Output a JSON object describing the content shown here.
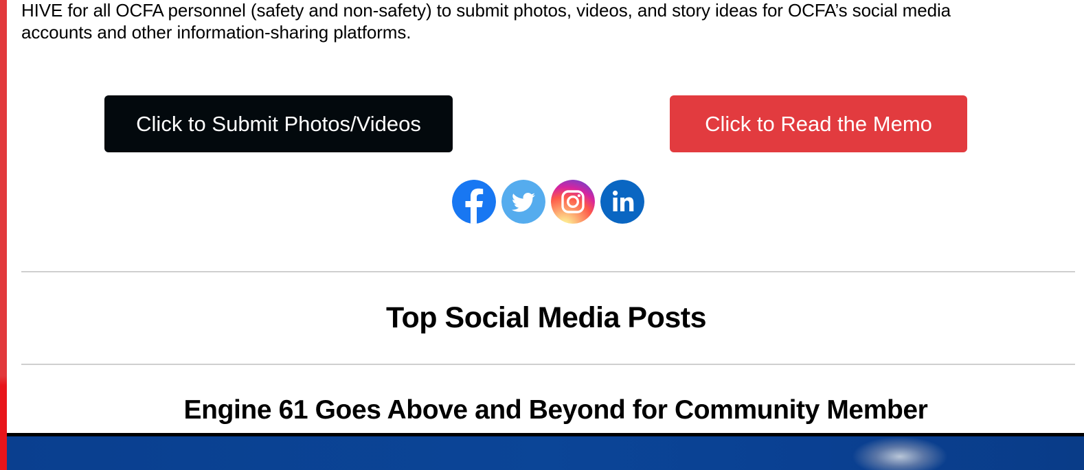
{
  "intro": {
    "line1": "HIVE for all OCFA personnel (safety and non-safety) to submit photos, videos, and story ideas for OCFA’s social media",
    "line2": "accounts and other information-sharing platforms."
  },
  "buttons": {
    "submit_label": "Click to Submit Photos/Videos",
    "memo_label": "Click to Read the Memo"
  },
  "social": [
    "facebook-icon",
    "twitter-icon",
    "instagram-icon",
    "linkedin-icon"
  ],
  "colors": {
    "accent_red": "#e23b3f",
    "button_black": "#03090d",
    "facebook": "#1877f2",
    "twitter": "#55acee",
    "linkedin": "#0a66c2",
    "divider": "#cfcfcf"
  },
  "sections": {
    "top_posts_heading": "Top Social Media Posts",
    "story_title": "Engine 61 Goes Above and Beyond for Community Member"
  }
}
